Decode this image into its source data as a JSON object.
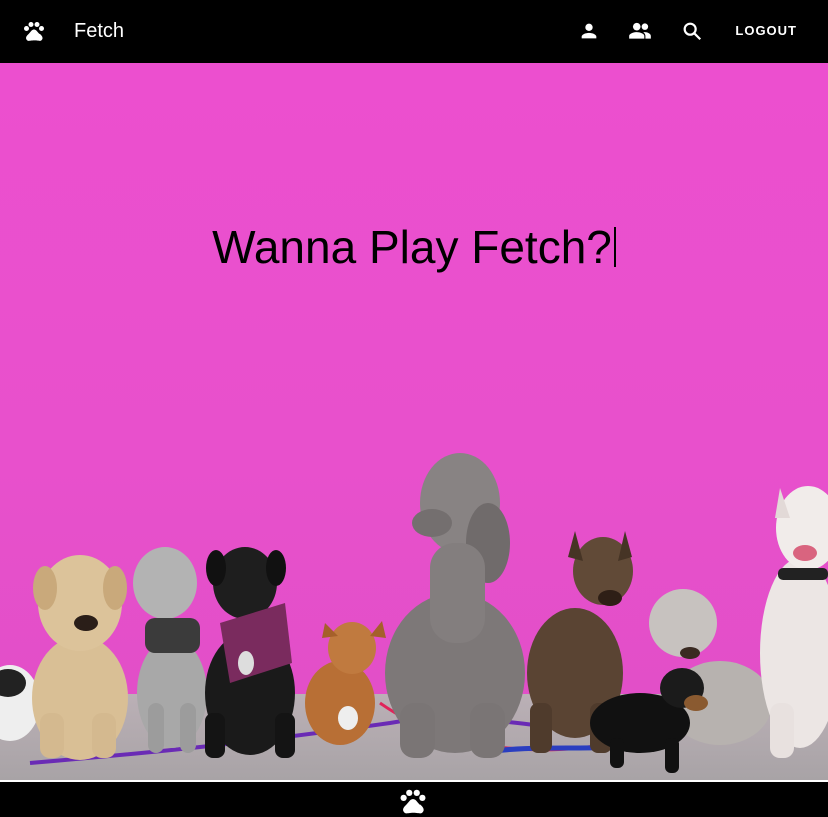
{
  "app": {
    "title": "Fetch"
  },
  "toolbar": {
    "logout_label": "LOGOUT",
    "icons": [
      "paw-icon",
      "person-icon",
      "people-icon",
      "search-icon"
    ]
  },
  "hero": {
    "headline": "Wanna Play Fetch?",
    "background_color": "#e850cc"
  },
  "footer": {
    "icon": "paw-icon"
  }
}
